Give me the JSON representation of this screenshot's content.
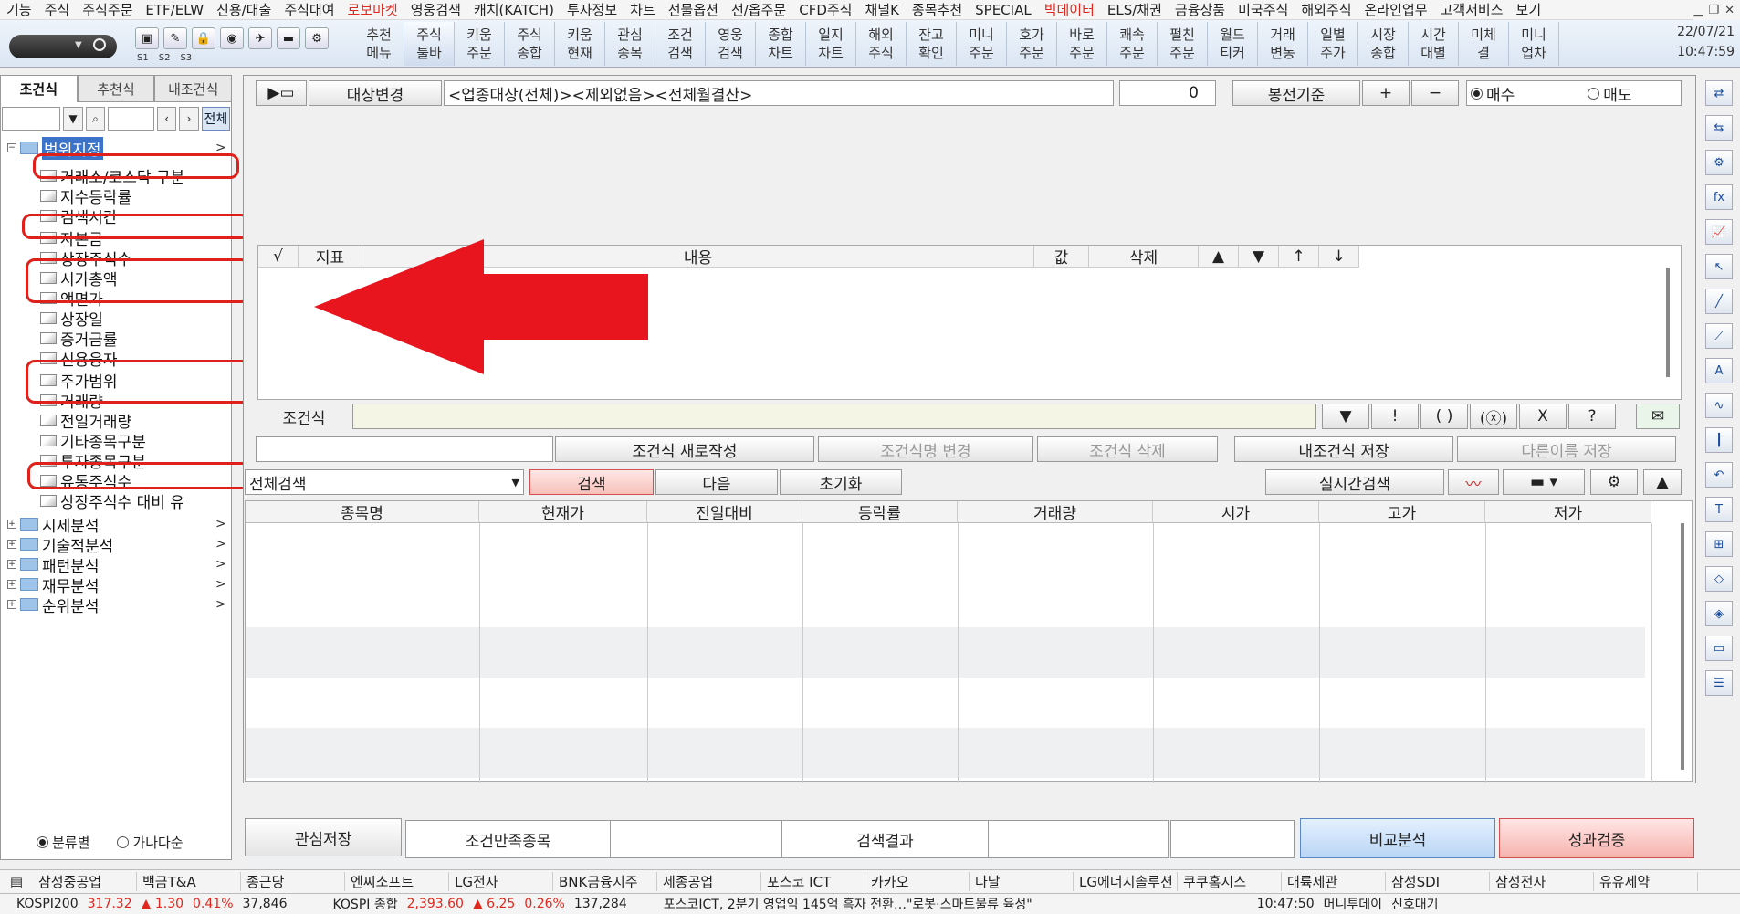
{
  "menu": [
    "기능",
    "주식",
    "주식주문",
    "ETF/ELW",
    "신용/대출",
    "주식대여",
    "로보마켓",
    "영웅검색",
    "캐치(KATCH)",
    "투자정보",
    "차트",
    "선물옵션",
    "선/옵주문",
    "CFD주식",
    "채널K",
    "종목추천",
    "SPECIAL",
    "빅데이터",
    "ELS/채권",
    "금융상품",
    "미국주식",
    "해외주식",
    "온라인업무",
    "고객서비스",
    "보기"
  ],
  "menu_red": [
    "로보마켓",
    "빅데이터"
  ],
  "toolbar": {
    "slabels": [
      "S1",
      "S2",
      "S3"
    ],
    "quick": [
      {
        "l1": "추천",
        "l2": "메뉴"
      },
      {
        "l1": "주식",
        "l2": "툴바"
      },
      {
        "l1": "키움",
        "l2": "주문"
      },
      {
        "l1": "주식",
        "l2": "종합"
      },
      {
        "l1": "키움",
        "l2": "현재"
      },
      {
        "l1": "관심",
        "l2": "종목"
      },
      {
        "l1": "조건",
        "l2": "검색"
      },
      {
        "l1": "영웅",
        "l2": "검색"
      },
      {
        "l1": "종합",
        "l2": "차트"
      },
      {
        "l1": "일지",
        "l2": "차트"
      },
      {
        "l1": "해외",
        "l2": "주식"
      },
      {
        "l1": "잔고",
        "l2": "확인"
      },
      {
        "l1": "미니",
        "l2": "주문"
      },
      {
        "l1": "호가",
        "l2": "주문"
      },
      {
        "l1": "바로",
        "l2": "주문"
      },
      {
        "l1": "쾌속",
        "l2": "주문"
      },
      {
        "l1": "펄친",
        "l2": "주문"
      },
      {
        "l1": "월드",
        "l2": "티커"
      },
      {
        "l1": "거래",
        "l2": "변동"
      },
      {
        "l1": "일별",
        "l2": "주가"
      },
      {
        "l1": "시장",
        "l2": "종합"
      },
      {
        "l1": "시간",
        "l2": "대별"
      },
      {
        "l1": "미체",
        "l2": "결"
      },
      {
        "l1": "미니",
        "l2": "업차"
      }
    ],
    "date": "22/07/21",
    "time": "10:47:59"
  },
  "left": {
    "tabs": [
      "조건식",
      "추천식",
      "내조건식"
    ],
    "all_button": "전체",
    "root": "범위지정",
    "items": [
      "거래소/코스닥 구분",
      "지수등락률",
      "검색시간",
      "자본금",
      "상장주식수",
      "시가총액",
      "액면가",
      "상장일",
      "증거금률",
      "신용융자",
      "주가범위",
      "거래량",
      "전일거래량",
      "기타종목구분",
      "투자종목구분",
      "유통주식수",
      "상장주식수 대비 유"
    ],
    "groups": [
      "시세분석",
      "기술적분석",
      "패턴분석",
      "재무분석",
      "순위분석"
    ],
    "radio": [
      {
        "label": "분류별",
        "checked": true
      },
      {
        "label": "가나다순",
        "checked": false
      }
    ]
  },
  "main": {
    "target_change": "대상변경",
    "target_text": "<업종대상(전체)><제외없음><전체월결산>",
    "count_value": "0",
    "bong_label": "봉전기준",
    "plus": "+",
    "minus": "−",
    "buy_label": "매수",
    "sell_label": "매도",
    "grid1_headers": [
      "√",
      "지표",
      "내용",
      "값",
      "삭제",
      "▲",
      "▼",
      "↑",
      "↓"
    ],
    "formula_label": "조건식",
    "formula_btns": [
      "▼",
      "!",
      "( )",
      "(ⓧ)",
      "X",
      "?"
    ],
    "actions": [
      "조건식 새로작성",
      "조건식명 변경",
      "조건식 삭제",
      "내조건식 저장",
      "다른이름 저장"
    ],
    "scope": "전체검색",
    "search": "검색",
    "next": "다음",
    "reset": "초기화",
    "realtime": "실시간검색",
    "grid2_headers": [
      "종목명",
      "현재가",
      "전일대비",
      "등락률",
      "거래량",
      "시가",
      "고가",
      "저가"
    ],
    "save_interest": "관심저장",
    "result_tabs": [
      "조건만족종목",
      "검색결과"
    ],
    "compare": "비교분석",
    "perf": "성과검증"
  },
  "ticker1": [
    "삼성중공업",
    "백금T&A",
    "종근당",
    "엔씨소프트",
    "LG전자",
    "BNK금융지주",
    "세종공업",
    "포스코 ICT",
    "카카오",
    "다날",
    "LG에너지솔루션",
    "쿠쿠홈시스",
    "대륙제관",
    "삼성SDI",
    "삼성전자",
    "유유제약"
  ],
  "ticker2": {
    "k200_label": "KOSPI200",
    "k200_val": "317.32",
    "k200_chg": "▲ 1.30",
    "k200_pct": "0.41%",
    "k200_vol": "37,846",
    "kospi_label": "KOSPI 종합",
    "kospi_val": "2,393.60",
    "kospi_chg": "▲ 6.25",
    "kospi_pct": "0.26%",
    "kospi_vol": "137,284",
    "news": "포스코ICT, 2분기 영업익 145억 흑자 전환…\"로봇·스마트물류 육성\"",
    "time": "10:47:50",
    "src": "머니투데이",
    "status": "신호대기"
  }
}
